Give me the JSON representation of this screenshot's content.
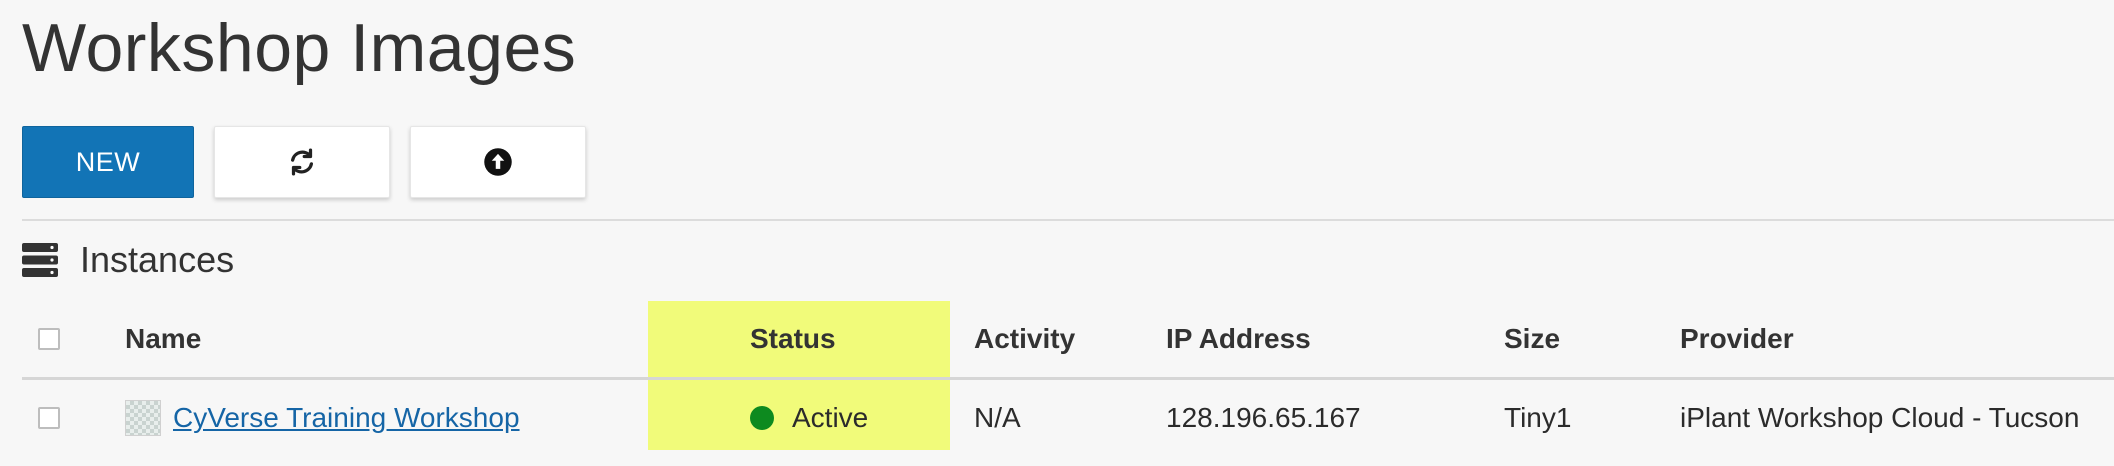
{
  "page": {
    "title": "Workshop Images"
  },
  "toolbar": {
    "new_label": "NEW",
    "refresh_icon": "refresh-icon",
    "upload_icon": "upload-arrow-icon"
  },
  "section": {
    "icon": "server-stack-icon",
    "title": "Instances"
  },
  "table": {
    "columns": [
      "Name",
      "Status",
      "Activity",
      "IP Address",
      "Size",
      "Provider"
    ],
    "rows": [
      {
        "name": "CyVerse Training Workshop",
        "status": "Active",
        "activity": "N/A",
        "ip": "128.196.65.167",
        "size": "Tiny1",
        "provider": "iPlant Workshop Cloud - Tucson"
      }
    ]
  },
  "colors": {
    "primary": "#1274b6",
    "highlight": "#f1fb7a",
    "status_active": "#0d8a1f",
    "link": "#1565a6"
  }
}
